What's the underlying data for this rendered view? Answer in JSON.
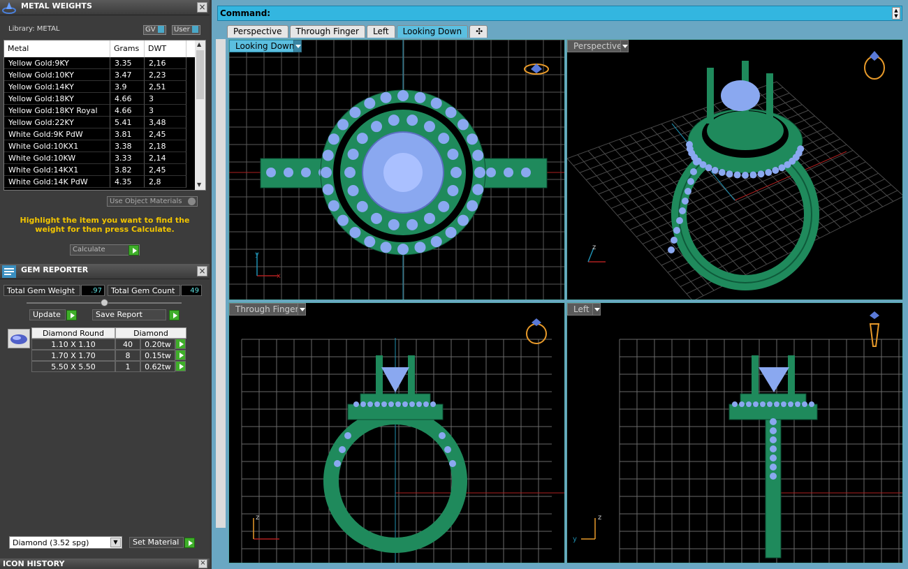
{
  "metal_weights": {
    "title": "METAL WEIGHTS",
    "library_label": "Library: METAL",
    "toggle_gv": "GV",
    "toggle_user": "User",
    "columns": [
      "Metal",
      "Grams",
      "DWT"
    ],
    "rows": [
      [
        "Yellow Gold:9KY",
        "3.35",
        "2,16"
      ],
      [
        "Yellow Gold:10KY",
        "3.47",
        "2,23"
      ],
      [
        "Yellow Gold:14KY",
        "3.9",
        "2,51"
      ],
      [
        "Yellow Gold:18KY",
        "4.66",
        "3"
      ],
      [
        "Yellow Gold:18KY Royal",
        "4.66",
        "3"
      ],
      [
        "Yellow Gold:22KY",
        "5.41",
        "3,48"
      ],
      [
        "White Gold:9K PdW",
        "3.81",
        "2,45"
      ],
      [
        "White Gold:10KX1",
        "3.38",
        "2,18"
      ],
      [
        "White Gold:10KW",
        "3.33",
        "2,14"
      ],
      [
        "White Gold:14KX1",
        "3.82",
        "2,45"
      ],
      [
        "White Gold:14K PdW",
        "4.35",
        "2,8"
      ]
    ],
    "use_object_materials": "Use Object Materials",
    "hint": "Highlight the item you want to find the weight for then press Calculate.",
    "calculate_label": "Calculate"
  },
  "gem_reporter": {
    "title": "GEM REPORTER",
    "total_weight_label": "Total Gem Weight",
    "total_weight_value": ".97",
    "total_count_label": "Total Gem Count",
    "total_count_value": "49",
    "update_label": "Update",
    "save_report_label": "Save Report",
    "columns": [
      "Diamond Round",
      "Diamond"
    ],
    "rows": [
      [
        "1.10 X 1.10",
        "40",
        "0.20tw"
      ],
      [
        "1.70 X 1.70",
        "8",
        "0.15tw"
      ],
      [
        "5.50 X 5.50",
        "1",
        "0.62tw"
      ]
    ],
    "material_select": "Diamond     (3.52 spg)",
    "set_material_label": "Set Material"
  },
  "icon_history": {
    "title": "ICON HISTORY"
  },
  "command": {
    "label": "Command:"
  },
  "tabs": [
    "Perspective",
    "Through Finger",
    "Left",
    "Looking Down"
  ],
  "active_tab": "Looking Down",
  "viewports": {
    "top_left": "Looking Down",
    "top_right": "Perspective",
    "bottom_left": "Through Finger",
    "bottom_right": "Left"
  },
  "axis_labels": {
    "x": "x",
    "y": "y",
    "z": "z"
  },
  "colors": {
    "ring_green": "#1f8a5c",
    "gem_blue": "#8aa8f0",
    "grid": "#6a6a6a",
    "active_blue": "#5bbfe0",
    "highlight_yellow": "#f2c500"
  },
  "icons": [
    "close-icon",
    "add-tab-icon",
    "gem-icon",
    "ring-icon",
    "play-icon"
  ]
}
